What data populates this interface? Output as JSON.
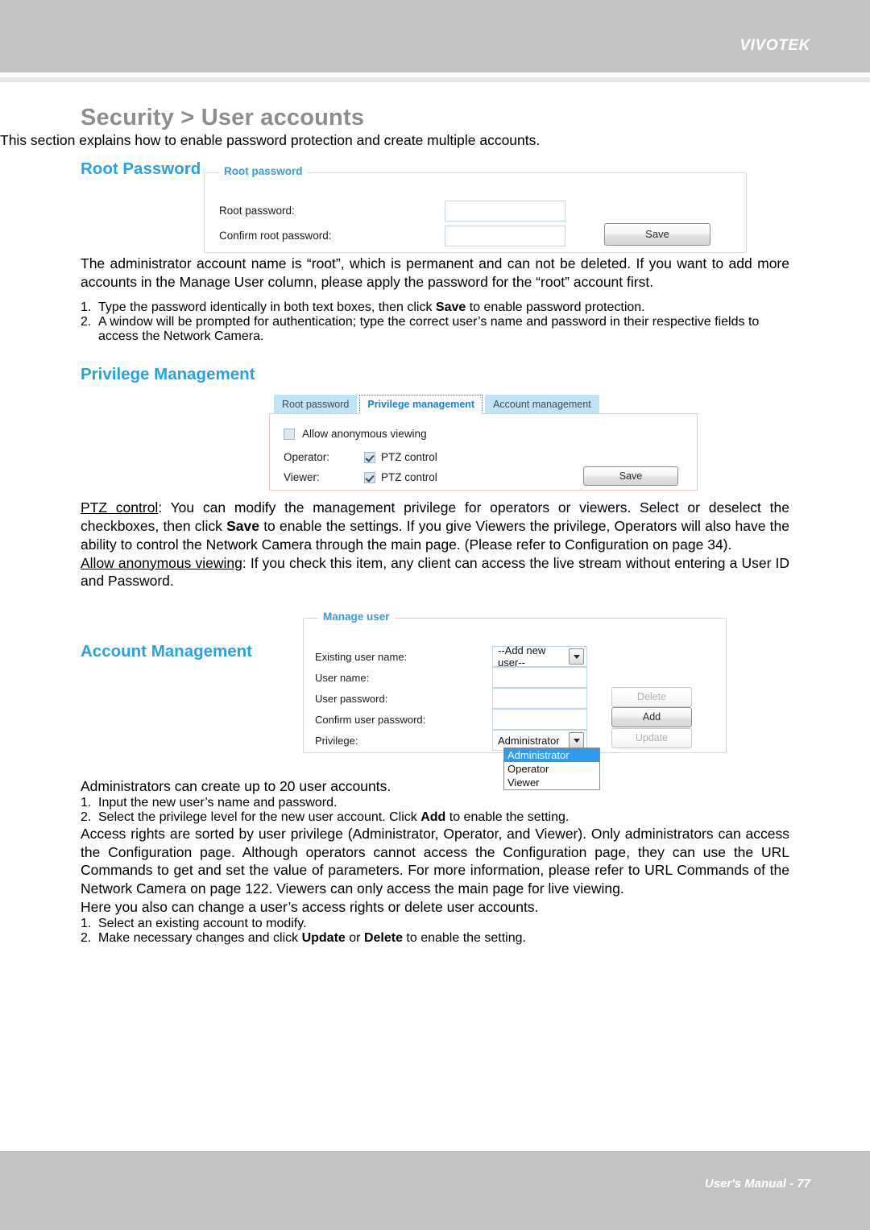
{
  "header": {
    "brand": "VIVOTEK"
  },
  "footer": {
    "text": "User's Manual - 77"
  },
  "page": {
    "title": "Security > User accounts",
    "intro": "This section explains how to enable password protection and create multiple accounts."
  },
  "root_password": {
    "heading": "Root Password",
    "panel_legend": "Root password",
    "fields": [
      {
        "label": "Root password:",
        "value": ""
      },
      {
        "label": "Confirm root password:",
        "value": ""
      }
    ],
    "save_label": "Save"
  },
  "root_password_text": {
    "paragraph": "The administrator account name is “root”, which is permanent and can not be deleted. If you want to add more accounts in the Manage User column, please apply the password for the “root” account first.",
    "steps": [
      {
        "num": "1.",
        "pre": "Type the password identically in both text boxes, then click ",
        "bold": "Save",
        "post": " to enable password protection."
      },
      {
        "num": "2.",
        "pre": "A window will be prompted for authentication; type the correct user’s name and password in their respective fields to access the Network Camera.",
        "bold": "",
        "post": ""
      }
    ]
  },
  "privilege": {
    "heading": "Privilege Management",
    "tabs": [
      {
        "label": "Root password",
        "active": false
      },
      {
        "label": "Privilege management",
        "active": true
      },
      {
        "label": "Account management",
        "active": false
      }
    ],
    "anonymous": {
      "label": "Allow anonymous viewing",
      "checked": false
    },
    "rows": [
      {
        "label": "Operator:",
        "checkbox_label": "PTZ control",
        "checked": true
      },
      {
        "label": "Viewer:",
        "checkbox_label": "PTZ control",
        "checked": true
      }
    ],
    "save_label": "Save"
  },
  "privilege_text": {
    "ptz_term": "PTZ control",
    "ptz_1": ": You can modify the management privilege for operators or viewers. Select or deselect the checkboxes, then click ",
    "ptz_bold": "Save",
    "ptz_2": " to enable the settings. If you give Viewers the privilege, Operators will also have the ability to control the Network Camera through the main page. (Please refer to Configuration on page 34).",
    "anon_term": "Allow anonymous viewing",
    "anon_text": ": If you check this item, any client can access the live stream without entering a User ID and Password."
  },
  "account": {
    "heading": "Account Management",
    "panel_legend": "Manage user",
    "fields": [
      {
        "label": "Existing user name:",
        "value": "--Add new user--",
        "type": "select"
      },
      {
        "label": "User name:",
        "value": "",
        "type": "text"
      },
      {
        "label": "User password:",
        "value": "",
        "type": "text"
      },
      {
        "label": "Confirm user password:",
        "value": "",
        "type": "text"
      },
      {
        "label": "Privilege:",
        "value": "Administrator",
        "type": "select"
      }
    ],
    "buttons": [
      {
        "label": "Delete",
        "disabled": true
      },
      {
        "label": "Add",
        "disabled": false
      },
      {
        "label": "Update",
        "disabled": true
      }
    ],
    "privilege_options": [
      {
        "label": "Administrator",
        "selected": true
      },
      {
        "label": "Operator",
        "selected": false
      },
      {
        "label": "Viewer",
        "selected": false
      }
    ]
  },
  "account_text": {
    "intro": "Administrators can create up to 20 user accounts.",
    "steps": [
      {
        "num": "1.",
        "pre": "Input the new user’s name and password.",
        "bold": "",
        "post": ""
      },
      {
        "num": "2.",
        "pre": "Select the privilege level for the new user account. Click ",
        "bold": "Add",
        "post": " to enable the setting."
      }
    ],
    "access_paragraph": "Access rights are sorted by user privilege (Administrator, Operator, and Viewer). Only administrators can access the Configuration page. Although operators cannot access the Configuration page, they can use the URL Commands to get and set the value of parameters. For more information, please refer to URL Commands of the Network Camera on page 122. Viewers can only access the main page for live viewing.",
    "here_intro": "Here you also can change a user’s access rights or delete user accounts.",
    "here_steps": [
      {
        "num": "1.",
        "pre": "Select an existing account to modify.",
        "bold": "",
        "mid": "",
        "bold2": "",
        "post": ""
      },
      {
        "num": "2.",
        "pre": "Make necessary changes and click ",
        "bold": "Update",
        "mid": " or ",
        "bold2": "Delete",
        "post": " to enable the setting."
      }
    ]
  },
  "colors": {
    "accent": "#28a3e1",
    "header_bar": "#c2c4c4",
    "tab": "#bfe4f7",
    "dropdown_highlight": "#2e9bef"
  }
}
